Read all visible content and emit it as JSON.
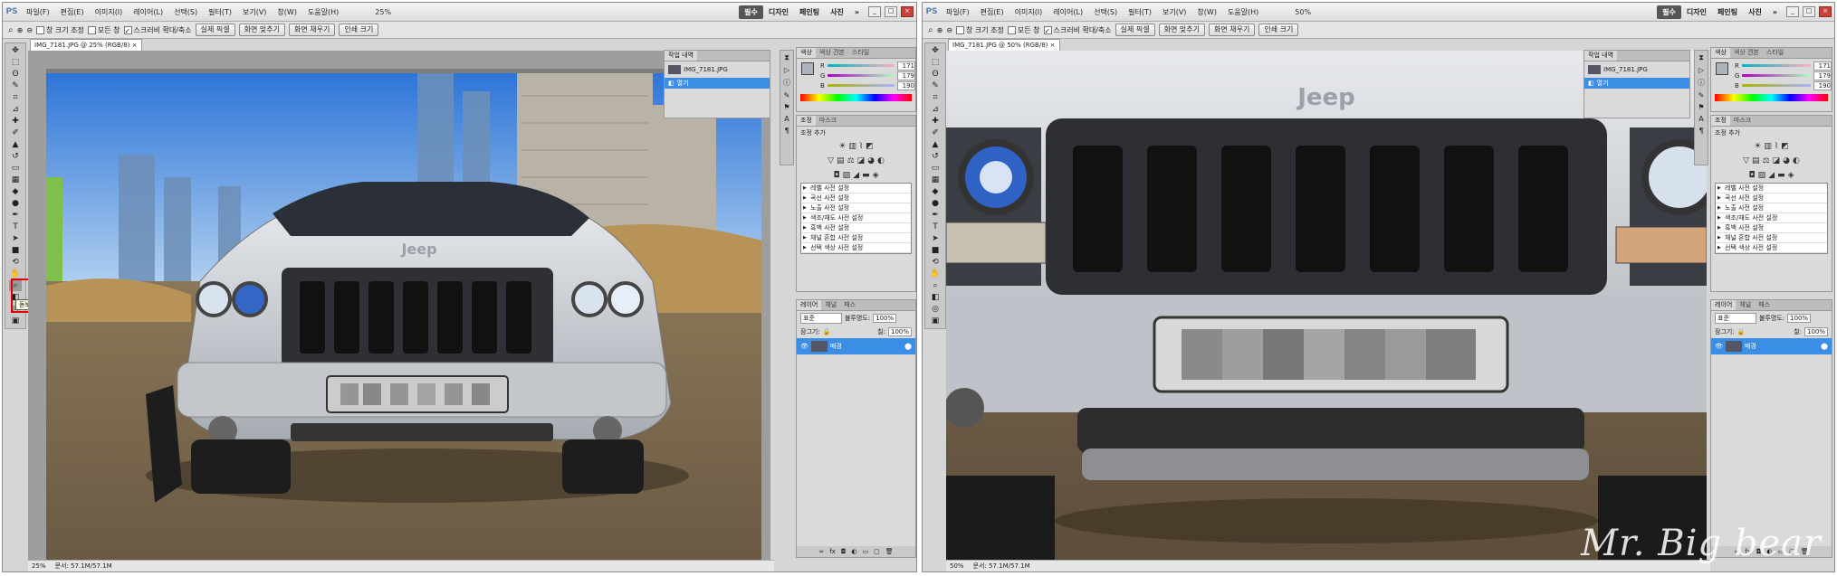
{
  "menu": {
    "logo": "PS",
    "items": [
      "파일(F)",
      "편집(E)",
      "이미지(I)",
      "레이어(L)",
      "선택(S)",
      "필터(T)",
      "보기(V)",
      "창(W)",
      "도움말(H)"
    ],
    "zoom_left": "25%",
    "zoom_right": "50%",
    "workspaces": [
      "필수",
      "디자인",
      "페인팅",
      "사진"
    ],
    "more": "»"
  },
  "options": {
    "resize_windows": "창 크기 조정",
    "all_windows": "모든 창",
    "scrubby_zoom": "스크러비 확대/축소",
    "actual_pixels": "실제 픽셀",
    "fit_screen": "화면 맞추기",
    "fill_screen": "화면 채우기",
    "print_size": "인쇄 크기"
  },
  "left_window": {
    "doc_tab": "IMG_7181.JPG @ 25% (RGB/8)",
    "status_zoom": "25%",
    "status_doc": "문서: 57.1M/57.1M",
    "tooltip": "돋보기 도구 (Z)"
  },
  "right_window": {
    "doc_tab": "IMG_7181.JPG @ 50% (RGB/8)",
    "status_zoom": "50%",
    "status_doc": "문서: 57.1M/57.1M"
  },
  "history": {
    "tab": "작업 내역",
    "snapshot": "IMG_7181.JPG",
    "step": "열기"
  },
  "color": {
    "tabs": [
      "색상",
      "색상 견본",
      "스타일"
    ],
    "r": "171",
    "g": "179",
    "b": "190",
    "r_label": "R",
    "g_label": "G",
    "b_label": "B"
  },
  "adjustments": {
    "tabs": [
      "조정",
      "마스크"
    ],
    "header": "조정 추가",
    "presets": [
      "레벨 사전 설정",
      "곡선 사전 설정",
      "노출 사전 설정",
      "색조/채도 사전 설정",
      "흑백 사전 설정",
      "채널 혼합 사전 설정",
      "선택 색상 사전 설정"
    ]
  },
  "layers": {
    "tabs": [
      "레이어",
      "채널",
      "패스"
    ],
    "blend": "표준",
    "opacity_label": "불투명도:",
    "opacity": "100%",
    "lock_label": "잠그기:",
    "fill_label": "칠:",
    "fill": "100%",
    "layer_name": "배경"
  },
  "photo": {
    "brand": "Jeep"
  },
  "watermark": "Mr. Big bear",
  "colors": {
    "accent_blue": "#3a8ee6",
    "tooltip_outline": "#e00000"
  }
}
